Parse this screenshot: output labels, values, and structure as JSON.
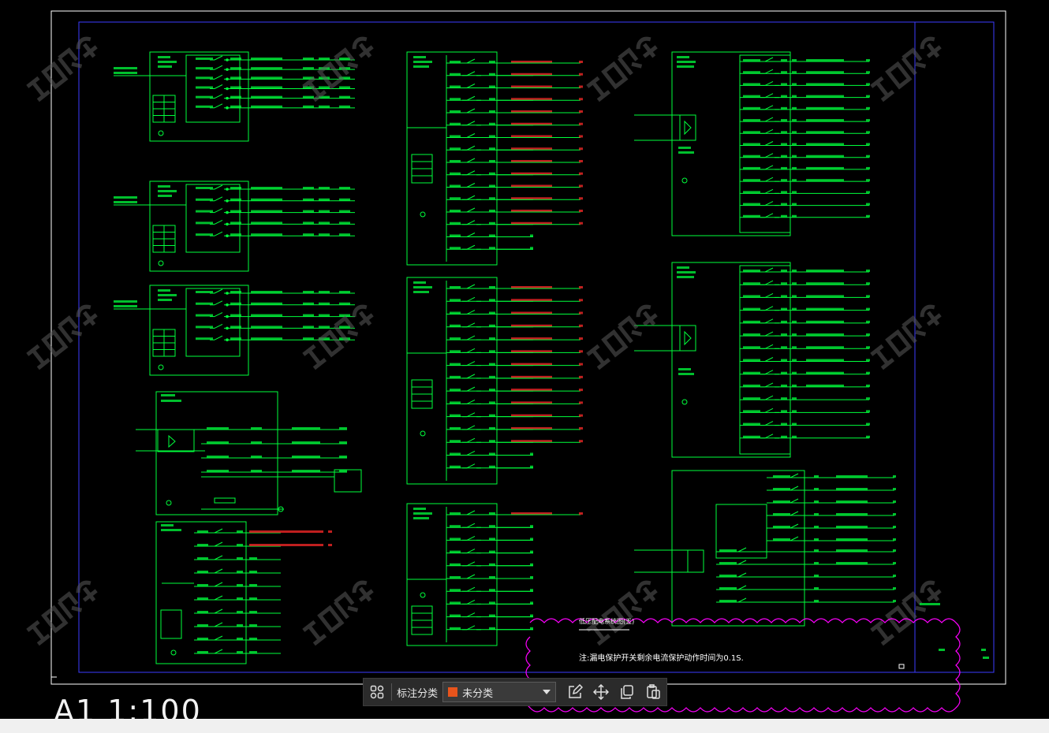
{
  "drawing": {
    "note_title": "低压配电系统图(五)",
    "note_text": "注:漏电保护开关剩余电流保护动作时间为0.1S.",
    "scale_label": "A1  1:100"
  },
  "toolbar": {
    "label": "标注分类",
    "select_value": "未分类",
    "select_color": "#e8541c"
  },
  "colors": {
    "line": "#00ff3c",
    "red_text": "#ff2a2a",
    "frame": "#3c3cff",
    "cloud": "#ff00ff",
    "watermark": "#5a5a5a"
  },
  "icons": [
    "group-icon",
    "edit-icon",
    "move-icon",
    "copy-icon",
    "paste-icon"
  ]
}
